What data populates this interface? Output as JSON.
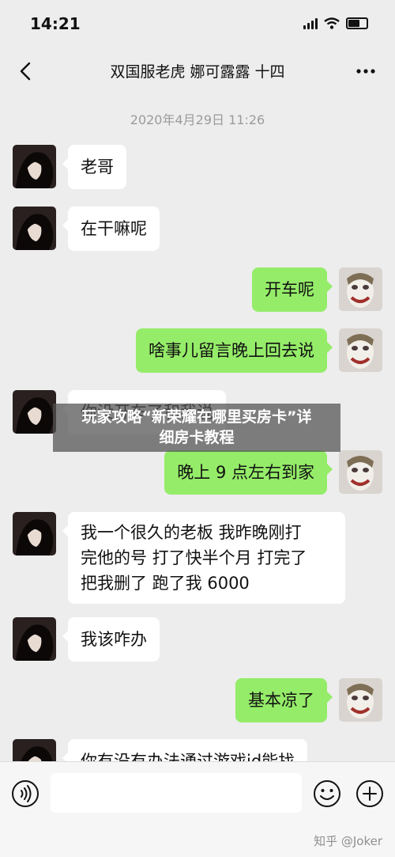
{
  "status_bar": {
    "time": "14:21"
  },
  "nav": {
    "title": "双国服老虎 娜可露露 十四"
  },
  "timestamp": "2020年4月29日 11:26",
  "messages": [
    {
      "side": "left",
      "text": "老哥"
    },
    {
      "side": "left",
      "text": "在干嘛呢"
    },
    {
      "side": "right",
      "text": "开车呢"
    },
    {
      "side": "right",
      "text": "啥事儿留言晚上回去说"
    },
    {
      "side": "left",
      "text": "你没开车了和我说"
    },
    {
      "side": "right",
      "text": "晚上 9 点左右到家"
    },
    {
      "side": "left",
      "lines": [
        "我一个很久的老板 我昨晚刚打",
        "完他的号 打了快半个月  打完了",
        "把我删了 跑了我 6000"
      ]
    },
    {
      "side": "left",
      "text": "我该咋办"
    },
    {
      "side": "right",
      "text": "基本凉了"
    },
    {
      "side": "left",
      "text": "你有没有办法通过游戏id能找"
    }
  ],
  "overlay": {
    "title_line1": "玩家攻略“新荣耀在哪里买房卡”详",
    "title_line2": "细房卡教程"
  },
  "input": {
    "value": ""
  },
  "watermark": "知乎 @Joker",
  "colors": {
    "background": "#ededed",
    "sent_bubble": "#95ec69",
    "received_bubble": "#ffffff"
  }
}
